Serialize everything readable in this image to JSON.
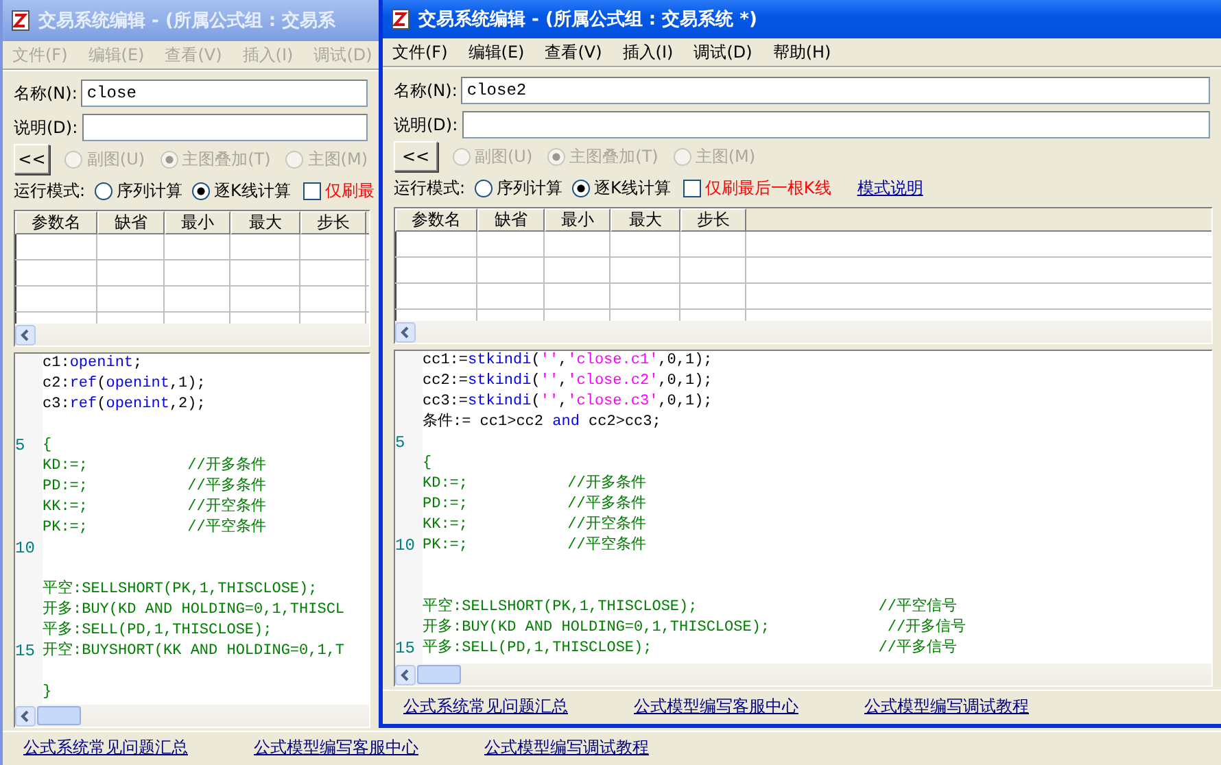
{
  "windows": [
    {
      "active": false,
      "title": "交易系统编辑 - (所属公式组 : 交易系",
      "menu": [
        {
          "label": "文件(F)",
          "disabled": true
        },
        {
          "label": "编辑(E)",
          "disabled": true
        },
        {
          "label": "查看(V)",
          "disabled": true
        },
        {
          "label": "插入(I)",
          "disabled": true
        },
        {
          "label": "调试(D)",
          "disabled": true
        }
      ],
      "name_field": {
        "label": "名称(N):",
        "value": "close"
      },
      "description_field": {
        "label": "说明(D):"
      },
      "collapse_button": "<<",
      "view_options": [
        {
          "label": "副图(U)",
          "selected": false,
          "disabled": true
        },
        {
          "label": "主图叠加(T)",
          "selected": true,
          "disabled": true
        },
        {
          "label": "主图(M)",
          "selected": false,
          "disabled": true
        }
      ],
      "run_mode": {
        "label": "运行模式:",
        "options": [
          {
            "label": "序列计算",
            "selected": false
          },
          {
            "label": "逐K线计算",
            "selected": true
          }
        ],
        "refresh_last_bar": {
          "label": "仅刷最",
          "checked": false
        }
      },
      "parameters_table": {
        "columns": [
          "参数名",
          "缺省",
          "最小",
          "最大",
          "步长"
        ]
      },
      "code_lines": [
        {
          "segments": [
            {
              "text": "c1:",
              "kind": "plain"
            },
            {
              "text": "openint",
              "kind": "function"
            },
            {
              "text": ";",
              "kind": "plain"
            }
          ]
        },
        {
          "segments": [
            {
              "text": "c2:",
              "kind": "plain"
            },
            {
              "text": "ref",
              "kind": "function"
            },
            {
              "text": "(",
              "kind": "plain"
            },
            {
              "text": "openint",
              "kind": "function"
            },
            {
              "text": ",1);",
              "kind": "plain"
            }
          ]
        },
        {
          "segments": [
            {
              "text": "c3:",
              "kind": "plain"
            },
            {
              "text": "ref",
              "kind": "function"
            },
            {
              "text": "(",
              "kind": "plain"
            },
            {
              "text": "openint",
              "kind": "function"
            },
            {
              "text": ",2);",
              "kind": "plain"
            }
          ]
        },
        {
          "number": "5",
          "blank_before": true,
          "segments": [
            {
              "text": "{",
              "kind": "signal"
            }
          ]
        },
        {
          "segments": [
            {
              "text": "KD:=;           //开多条件",
              "kind": "signal"
            }
          ]
        },
        {
          "segments": [
            {
              "text": "PD:=;           //平多条件",
              "kind": "signal"
            }
          ]
        },
        {
          "segments": [
            {
              "text": "KK:=;           //开空条件",
              "kind": "signal"
            }
          ]
        },
        {
          "segments": [
            {
              "text": "PK:=;           //平空条件",
              "kind": "signal"
            }
          ]
        },
        {
          "number": "10"
        },
        {
          "blank_before": true,
          "segments": [
            {
              "text": "平空:SELLSHORT(PK,1,THISCLOSE);",
              "kind": "signal"
            }
          ]
        },
        {
          "segments": [
            {
              "text": "开多:BUY(KD AND HOLDING=0,1,THISCL",
              "kind": "signal"
            }
          ]
        },
        {
          "segments": [
            {
              "text": "平多:SELL(PD,1,THISCLOSE);",
              "kind": "signal"
            }
          ]
        },
        {
          "number": "15",
          "segments": [
            {
              "text": "开空:BUYSHORT(KK AND HOLDING=0,1,T",
              "kind": "signal"
            }
          ]
        },
        {
          "blank_before": true,
          "segments": [
            {
              "text": "}",
              "kind": "signal"
            }
          ]
        }
      ],
      "links": [
        "公式系统常见问题汇总",
        "公式模型编写客服中心",
        "公式模型编写调试教程"
      ]
    },
    {
      "active": true,
      "title": "交易系统编辑 - (所属公式组 : 交易系统 *)",
      "menu": [
        {
          "label": "文件(F)",
          "disabled": false
        },
        {
          "label": "编辑(E)",
          "disabled": false
        },
        {
          "label": "查看(V)",
          "disabled": false
        },
        {
          "label": "插入(I)",
          "disabled": false
        },
        {
          "label": "调试(D)",
          "disabled": false
        },
        {
          "label": "帮助(H)",
          "disabled": false
        }
      ],
      "name_field": {
        "label": "名称(N):",
        "value": "close2"
      },
      "description_field": {
        "label": "说明(D):"
      },
      "collapse_button": "<<",
      "view_options": [
        {
          "label": "副图(U)",
          "selected": false,
          "disabled": true
        },
        {
          "label": "主图叠加(T)",
          "selected": true,
          "disabled": true
        },
        {
          "label": "主图(M)",
          "selected": false,
          "disabled": true
        }
      ],
      "run_mode": {
        "label": "运行模式:",
        "options": [
          {
            "label": "序列计算",
            "selected": false
          },
          {
            "label": "逐K线计算",
            "selected": true
          }
        ],
        "refresh_last_bar": {
          "label": "仅刷最后一根K线",
          "checked": false
        },
        "help_link": "模式说明"
      },
      "parameters_table": {
        "columns": [
          "参数名",
          "缺省",
          "最小",
          "最大",
          "步长"
        ]
      },
      "code_lines": [
        {
          "segments": [
            {
              "text": "cc1:=",
              "kind": "plain"
            },
            {
              "text": "stkindi",
              "kind": "function"
            },
            {
              "text": "(",
              "kind": "plain"
            },
            {
              "text": "''",
              "kind": "string"
            },
            {
              "text": ",",
              "kind": "plain"
            },
            {
              "text": "'close.c1'",
              "kind": "string"
            },
            {
              "text": ",0,1);",
              "kind": "plain"
            }
          ]
        },
        {
          "segments": [
            {
              "text": "cc2:=",
              "kind": "plain"
            },
            {
              "text": "stkindi",
              "kind": "function"
            },
            {
              "text": "(",
              "kind": "plain"
            },
            {
              "text": "''",
              "kind": "string"
            },
            {
              "text": ",",
              "kind": "plain"
            },
            {
              "text": "'close.c2'",
              "kind": "string"
            },
            {
              "text": ",0,1);",
              "kind": "plain"
            }
          ]
        },
        {
          "segments": [
            {
              "text": "cc3:=",
              "kind": "plain"
            },
            {
              "text": "stkindi",
              "kind": "function"
            },
            {
              "text": "(",
              "kind": "plain"
            },
            {
              "text": "''",
              "kind": "string"
            },
            {
              "text": ",",
              "kind": "plain"
            },
            {
              "text": "'close.c3'",
              "kind": "string"
            },
            {
              "text": ",0,1);",
              "kind": "plain"
            }
          ]
        },
        {
          "segments": [
            {
              "text": "条件:= cc1>cc2 ",
              "kind": "plain"
            },
            {
              "text": "and",
              "kind": "function"
            },
            {
              "text": " cc2>cc3;",
              "kind": "plain"
            }
          ]
        },
        {
          "number": "5"
        },
        {
          "segments": [
            {
              "text": "{",
              "kind": "signal"
            }
          ]
        },
        {
          "segments": [
            {
              "text": "KD:=;           //开多条件",
              "kind": "signal"
            }
          ]
        },
        {
          "segments": [
            {
              "text": "PD:=;           //平多条件",
              "kind": "signal"
            }
          ]
        },
        {
          "segments": [
            {
              "text": "KK:=;           //开空条件",
              "kind": "signal"
            }
          ]
        },
        {
          "number": "10",
          "blank_after": true,
          "segments": [
            {
              "text": "PK:=;           //平空条件",
              "kind": "signal"
            }
          ]
        },
        {
          "blank_before": true,
          "segments": [
            {
              "text": "平空:SELLSHORT(PK,1,THISCLOSE);                    //平空信号",
              "kind": "signal"
            }
          ]
        },
        {
          "segments": [
            {
              "text": "开多:BUY(KD AND HOLDING=0,1,THISCLOSE);             //开多信号",
              "kind": "signal"
            }
          ]
        },
        {
          "number": "15",
          "segments": [
            {
              "text": "平多:SELL(PD,1,THISCLOSE);                         //平多信号",
              "kind": "signal"
            }
          ]
        }
      ],
      "links": [
        "公式系统常见问题汇总",
        "公式模型编写客服中心",
        "公式模型编写调试教程"
      ]
    }
  ]
}
